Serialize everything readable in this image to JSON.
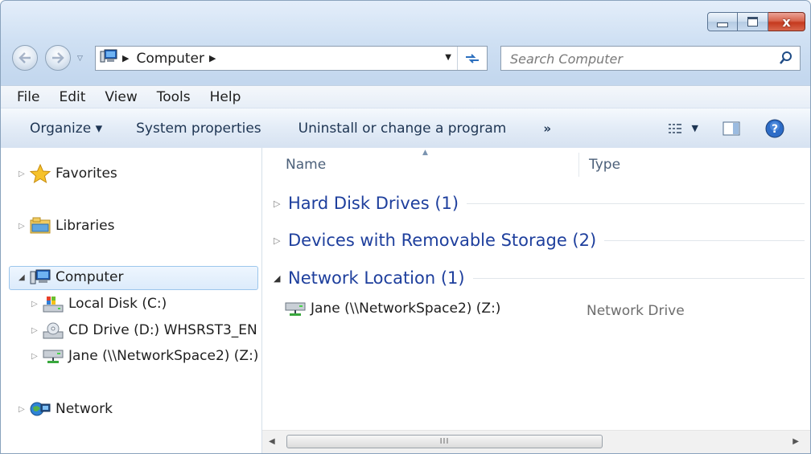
{
  "window": {
    "caption_buttons": {
      "close_glyph": "x"
    }
  },
  "address": {
    "crumbs": [
      "Computer"
    ],
    "computer_icon": "computer-icon"
  },
  "search": {
    "placeholder": "Search Computer"
  },
  "menu": [
    "File",
    "Edit",
    "View",
    "Tools",
    "Help"
  ],
  "commands": {
    "organize": "Organize ▾",
    "system_properties": "System properties",
    "uninstall": "Uninstall or change a program",
    "more": "»"
  },
  "nav": {
    "favorites": "Favorites",
    "libraries": "Libraries",
    "computer": "Computer",
    "local_disk": "Local Disk (C:)",
    "cd_drive": "CD Drive (D:) WHSRST3_EN",
    "network_drive": "Jane (\\\\NetworkSpace2) (Z:)",
    "network": "Network"
  },
  "columns": {
    "name": "Name",
    "type": "Type"
  },
  "groups": [
    {
      "label": "Hard Disk Drives (1)",
      "expanded": false
    },
    {
      "label": "Devices with Removable Storage (2)",
      "expanded": false
    },
    {
      "label": "Network Location (1)",
      "expanded": true
    }
  ],
  "items": [
    {
      "name": "Jane (\\\\NetworkSpace2) (Z:)",
      "type": "Network Drive",
      "icon": "network-drive-icon"
    }
  ],
  "scrollbar": {
    "grip": "III"
  },
  "colors": {
    "group_heading": "#1e3f9d",
    "selection_border": "#9cc6ec",
    "chrome": "#cfe0f3"
  }
}
